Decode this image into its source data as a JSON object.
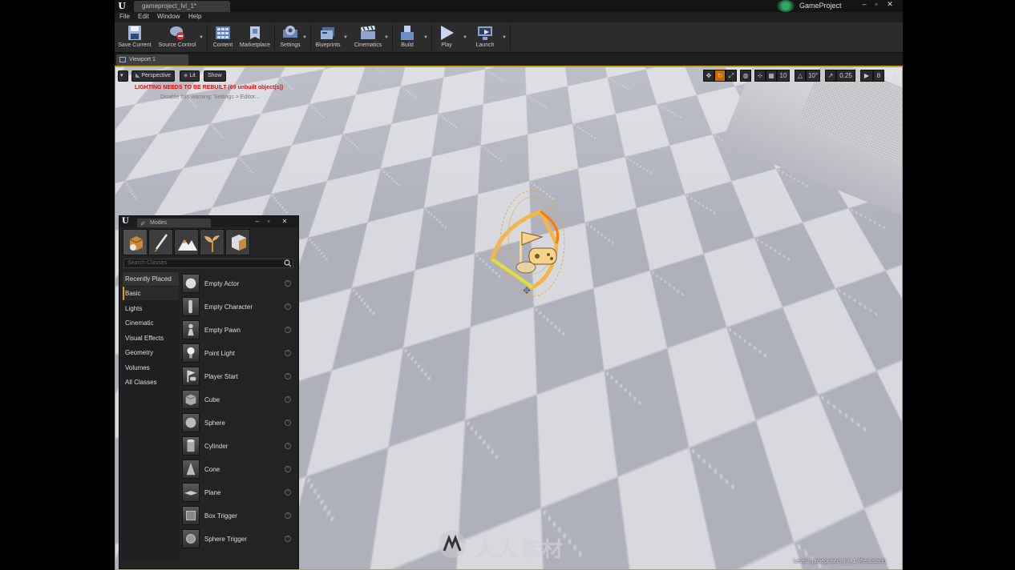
{
  "titlebar": {
    "document_tab": "gameproject_lvl_1*",
    "project_name": "GameProject",
    "minimize": "–",
    "maximize": "▫",
    "close": "✕"
  },
  "menu": {
    "items": [
      "File",
      "Edit",
      "Window",
      "Help"
    ]
  },
  "toolbar": {
    "buttons": [
      {
        "label": "Save Current",
        "icon": "save-icon"
      },
      {
        "label": "Source Control",
        "icon": "source-control-icon"
      },
      {
        "label": "Content",
        "icon": "content-icon"
      },
      {
        "label": "Marketplace",
        "icon": "marketplace-icon"
      },
      {
        "label": "Settings",
        "icon": "settings-icon"
      },
      {
        "label": "Blueprints",
        "icon": "blueprints-icon"
      },
      {
        "label": "Cinematics",
        "icon": "cinematics-icon"
      },
      {
        "label": "Build",
        "icon": "build-icon"
      },
      {
        "label": "Play",
        "icon": "play-icon"
      },
      {
        "label": "Launch",
        "icon": "launch-icon"
      }
    ]
  },
  "viewport": {
    "tab_label": "Viewport 1",
    "perspective_label": "Perspective",
    "lit_label": "Lit",
    "show_label": "Show",
    "warning": "LIGHTING NEEDS TO BE REBUILT (69 unbuilt object(s))",
    "warning_sub": "Disable this warning: Settings > Editor...",
    "grid_snap": "10",
    "rotation_snap": "10°",
    "scale_snap": "0.25",
    "camera_speed": "8",
    "status": "Level:  gameproject_lvl_1 (Persistent)"
  },
  "modes": {
    "tab_label": "Modes",
    "search_placeholder": "Search Classes",
    "categories": [
      "Recently Placed",
      "Basic",
      "Lights",
      "Cinematic",
      "Visual Effects",
      "Geometry",
      "Volumes",
      "All Classes"
    ],
    "active_category": "Basic",
    "items": [
      "Empty Actor",
      "Empty Character",
      "Empty Pawn",
      "Point Light",
      "Player Start",
      "Cube",
      "Sphere",
      "Cylinder",
      "Cone",
      "Plane",
      "Box Trigger",
      "Sphere Trigger"
    ]
  },
  "watermark": "人人素材",
  "colors": {
    "accent_orange": "#e0a000",
    "warning_red": "#e01010",
    "selection_gold": "#c8a21c"
  }
}
